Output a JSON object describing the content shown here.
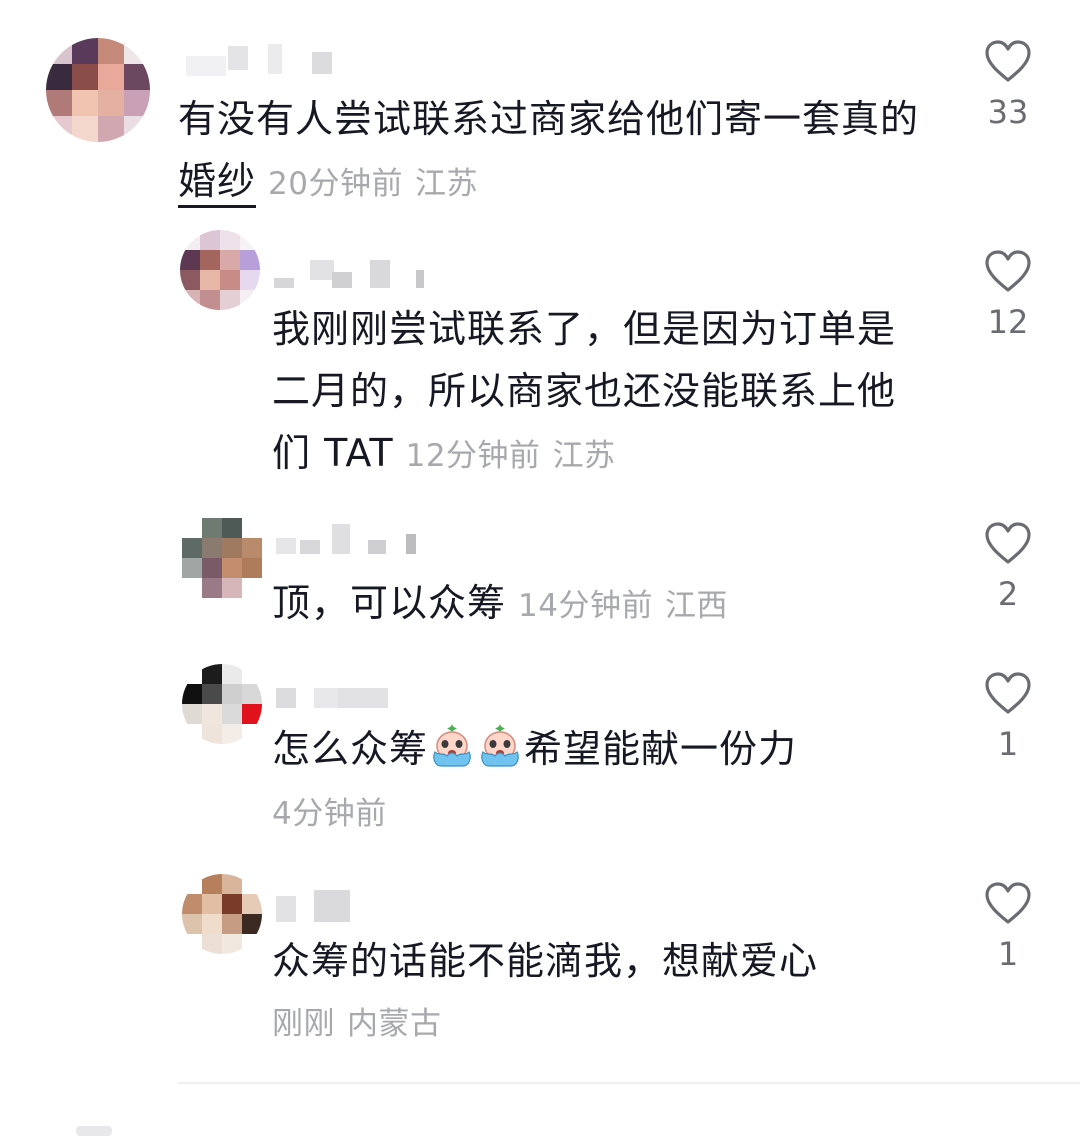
{
  "comments": [
    {
      "text_line1": "有没有人尝试联系过商家给他们寄一套真的",
      "text_word_underlined": "婚纱",
      "time": "20分钟前",
      "location": "江苏",
      "likes": "33",
      "liked": false
    },
    {
      "text_line1": "我刚刚尝试联系了，但是因为订单是",
      "text_line2": "二月的，所以商家也还没能联系上他",
      "text_line3": "们 TAT",
      "time": "12分钟前",
      "location": "江苏",
      "likes": "12",
      "liked": false
    },
    {
      "text_line1": "顶，可以众筹",
      "time": "14分钟前",
      "location": "江西",
      "likes": "2",
      "liked": false
    },
    {
      "text_before_emoji": "怎么众筹",
      "emoji": [
        "crying-face-emoji",
        "crying-face-emoji"
      ],
      "text_after_emoji": "希望能献一份力",
      "time": "4分钟前",
      "likes": "1",
      "liked": false
    },
    {
      "text_line1": "众筹的话能不能滴我，想献爱心",
      "time": "刚刚",
      "location": "内蒙古",
      "likes": "1",
      "liked": false
    }
  ],
  "colors": {
    "text": "#161823",
    "meta": "#a8a9ad",
    "heart_outline": "#6b6c72",
    "background": "#ffffff"
  }
}
